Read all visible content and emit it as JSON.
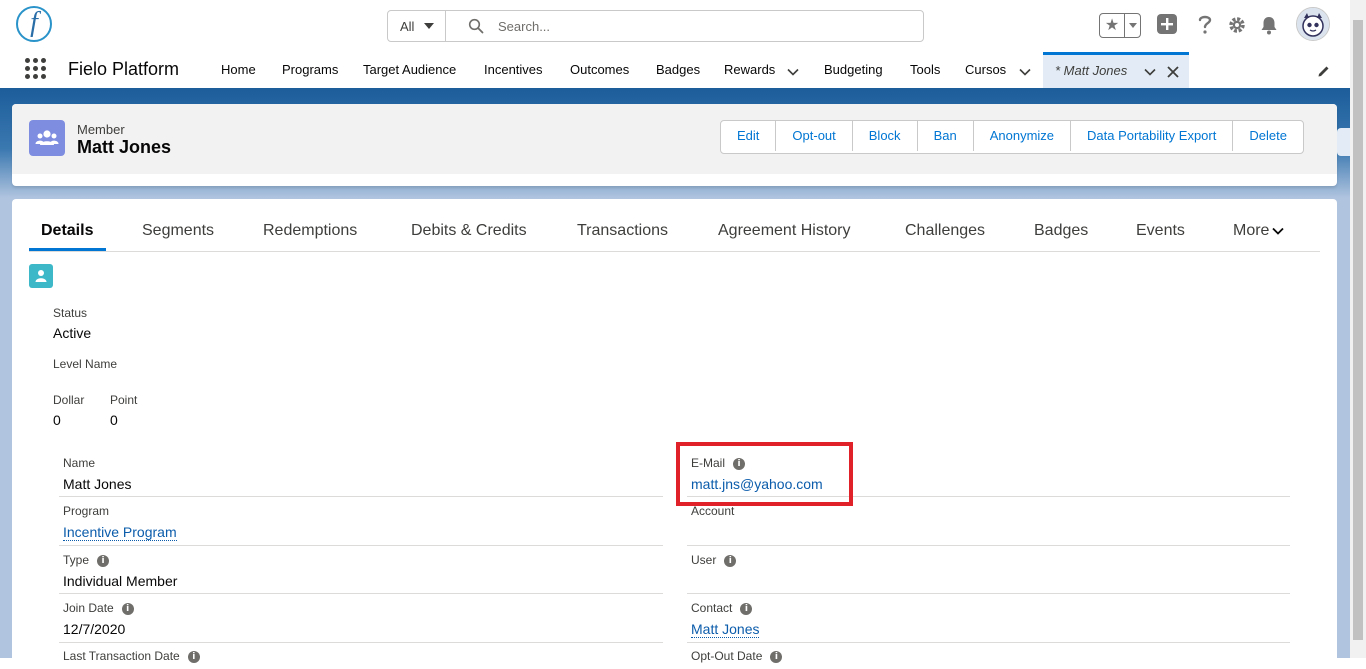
{
  "logo": {
    "letter": "f"
  },
  "search": {
    "scope": "All",
    "placeholder": "Search..."
  },
  "header_icons": [
    "favorites-star-icon",
    "favorites-dropdown-icon",
    "global-add-icon",
    "help-icon",
    "setup-gear-icon",
    "notifications-bell-icon",
    "user-avatar"
  ],
  "nav": {
    "app_name": "Fielo Platform",
    "items": [
      {
        "label": "Home"
      },
      {
        "label": "Programs"
      },
      {
        "label": "Target Audience"
      },
      {
        "label": "Incentives"
      },
      {
        "label": "Outcomes"
      },
      {
        "label": "Badges"
      },
      {
        "label": "Rewards",
        "dropdown": true
      },
      {
        "label": "Budgeting"
      },
      {
        "label": "Tools"
      },
      {
        "label": "Cursos",
        "dropdown": true
      }
    ],
    "active_tab": "* Matt Jones"
  },
  "record": {
    "type": "Member",
    "name": "Matt Jones",
    "actions": [
      "Edit",
      "Opt-out",
      "Block",
      "Ban",
      "Anonymize",
      "Data Portability Export",
      "Delete"
    ]
  },
  "tabs": [
    "Details",
    "Segments",
    "Redemptions",
    "Debits & Credits",
    "Transactions",
    "Agreement History",
    "Challenges",
    "Badges",
    "Events",
    "More"
  ],
  "active_tab": "Details",
  "summary": {
    "status_label": "Status",
    "status_value": "Active",
    "level_label": "Level Name",
    "dollar_label": "Dollar",
    "dollar_value": "0",
    "point_label": "Point",
    "point_value": "0"
  },
  "fields": {
    "name_label": "Name",
    "name_value": "Matt Jones",
    "email_label": "E-Mail",
    "email_value": "matt.jns@yahoo.com",
    "program_label": "Program",
    "program_value": "Incentive Program",
    "account_label": "Account",
    "type_label": "Type",
    "type_value": "Individual Member",
    "user_label": "User",
    "join_label": "Join Date",
    "join_value": "12/7/2020",
    "contact_label": "Contact",
    "contact_value": "Matt Jones",
    "last_tx_label": "Last Transaction Date",
    "optout_label": "Opt-Out Date"
  },
  "colors": {
    "brand": "#0176d3",
    "link": "#0b5cab",
    "highlight": "#e0212a",
    "member_icon": "#7f8de1",
    "contact_icon": "#3cb8c8"
  }
}
